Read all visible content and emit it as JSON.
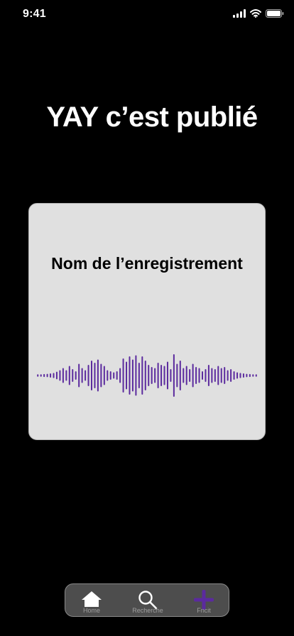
{
  "status_bar": {
    "time": "9:41",
    "icons": [
      "signal-icon",
      "wifi-icon",
      "battery-icon"
    ]
  },
  "headline": "YAY c’est publié",
  "card": {
    "title": "Nom de l’enregistrement",
    "waveform_color": "#5b2a9e",
    "waveform_amplitudes": [
      0.06,
      0.06,
      0.07,
      0.08,
      0.1,
      0.12,
      0.18,
      0.25,
      0.35,
      0.25,
      0.45,
      0.3,
      0.2,
      0.55,
      0.35,
      0.25,
      0.5,
      0.7,
      0.6,
      0.75,
      0.55,
      0.45,
      0.25,
      0.2,
      0.15,
      0.2,
      0.35,
      0.8,
      0.65,
      0.9,
      0.75,
      0.95,
      0.6,
      0.9,
      0.7,
      0.5,
      0.4,
      0.35,
      0.6,
      0.5,
      0.45,
      0.65,
      0.3,
      1.0,
      0.55,
      0.7,
      0.35,
      0.45,
      0.3,
      0.55,
      0.4,
      0.35,
      0.2,
      0.3,
      0.5,
      0.35,
      0.3,
      0.45,
      0.35,
      0.4,
      0.25,
      0.3,
      0.2,
      0.15,
      0.12,
      0.1,
      0.08,
      0.07,
      0.06,
      0.06
    ]
  },
  "tab_bar": {
    "accent": "#5b2a9e",
    "tabs": [
      {
        "label": "Home",
        "icon": "home-icon"
      },
      {
        "label": "Recherche",
        "icon": "search-icon"
      },
      {
        "label": "Fncit",
        "icon": "plus-icon"
      }
    ]
  }
}
